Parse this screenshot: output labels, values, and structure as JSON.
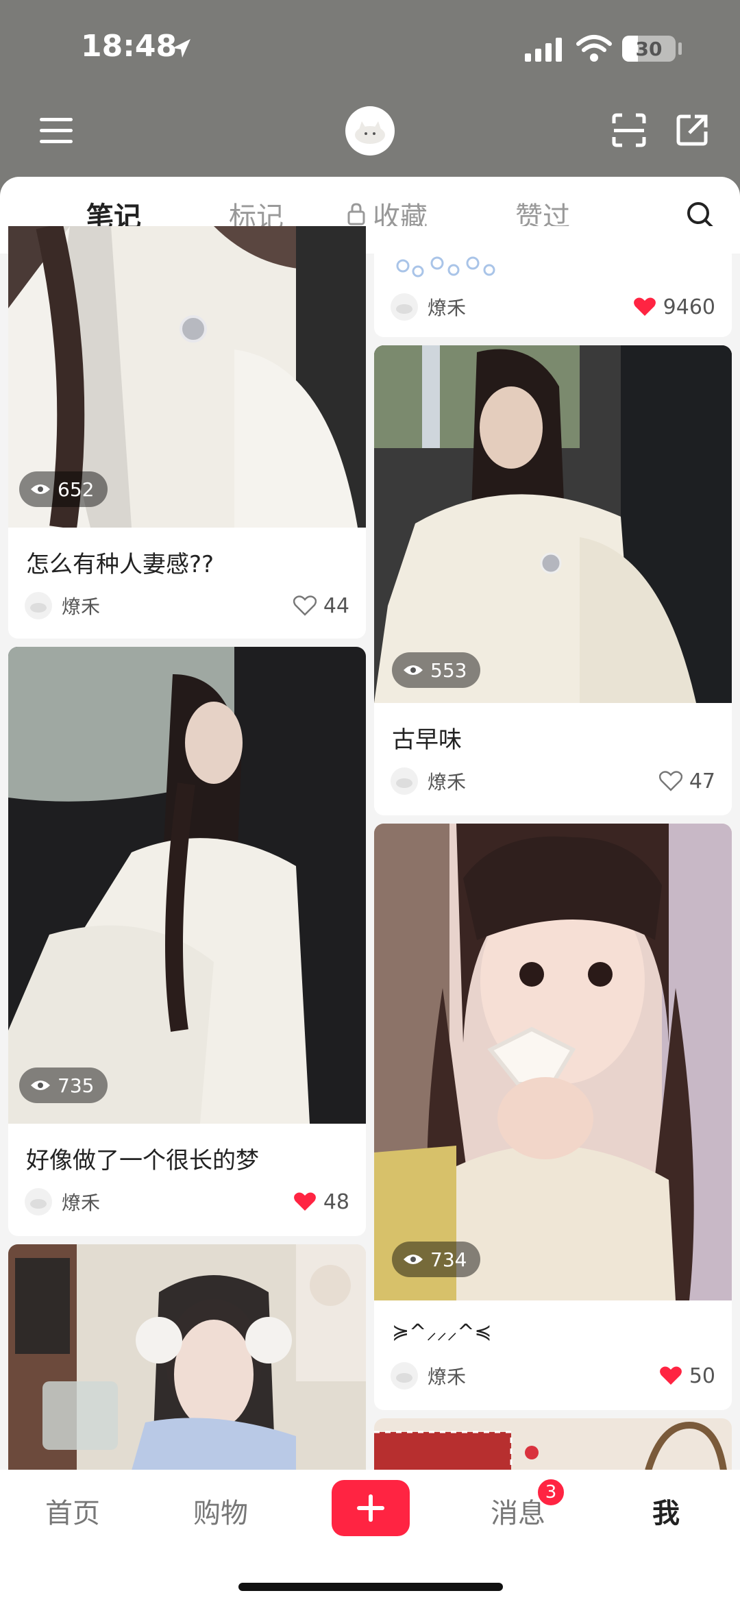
{
  "status_bar": {
    "time": "18:48",
    "battery": "30"
  },
  "tabs": [
    {
      "label": "笔记",
      "active": true
    },
    {
      "label": "标记",
      "active": false
    },
    {
      "label": "收藏",
      "active": false
    },
    {
      "label": "赞过",
      "active": false
    }
  ],
  "posts": {
    "left": [
      {
        "views": "652",
        "title": "怎么有种人妻感??",
        "author": "燎禾",
        "likes": "44",
        "liked": false
      },
      {
        "views": "735",
        "title": "好像做了一个很长的梦",
        "author": "燎禾",
        "likes": "48",
        "liked": true
      }
    ],
    "right": [
      {
        "author": "燎禾",
        "likes": "9460",
        "liked": true
      },
      {
        "views": "553",
        "title": "古早味",
        "author": "燎禾",
        "likes": "47",
        "liked": false
      },
      {
        "views": "734",
        "title": "≽^⸝⸝⸝^≼",
        "author": "燎禾",
        "likes": "50",
        "liked": true
      }
    ]
  },
  "bottom_nav": {
    "home": "首页",
    "shop": "购物",
    "add": "+",
    "messages": "消息",
    "messages_badge": "3",
    "me": "我"
  },
  "colors": {
    "accent": "#ff2442",
    "header_bg": "#7b7b78"
  }
}
